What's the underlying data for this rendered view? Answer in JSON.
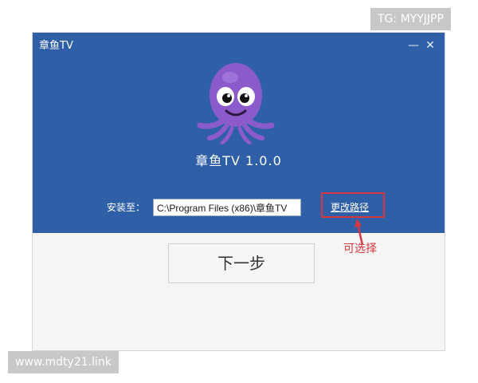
{
  "watermarks": {
    "top": "TG: MYYJJPP",
    "bottom": "www.mdty21.link"
  },
  "window": {
    "title": "章鱼TV",
    "controls": {
      "minimize": "—",
      "close": "✕"
    }
  },
  "installer": {
    "app_name": "章鱼TV 1.0.0",
    "path_label": "安装至：",
    "path_value": "C:\\Program Files (x86)\\章鱼TV",
    "change_path_link": "更改路径",
    "next_button": "下一步"
  },
  "annotation": {
    "text": "可选择",
    "color": "#d8363e"
  },
  "colors": {
    "header_bg": "#2f5fa6",
    "mascot": "#8b5bcc"
  },
  "icons": {
    "mascot": "octopus-logo-icon",
    "arrow": "arrow-up-icon"
  }
}
